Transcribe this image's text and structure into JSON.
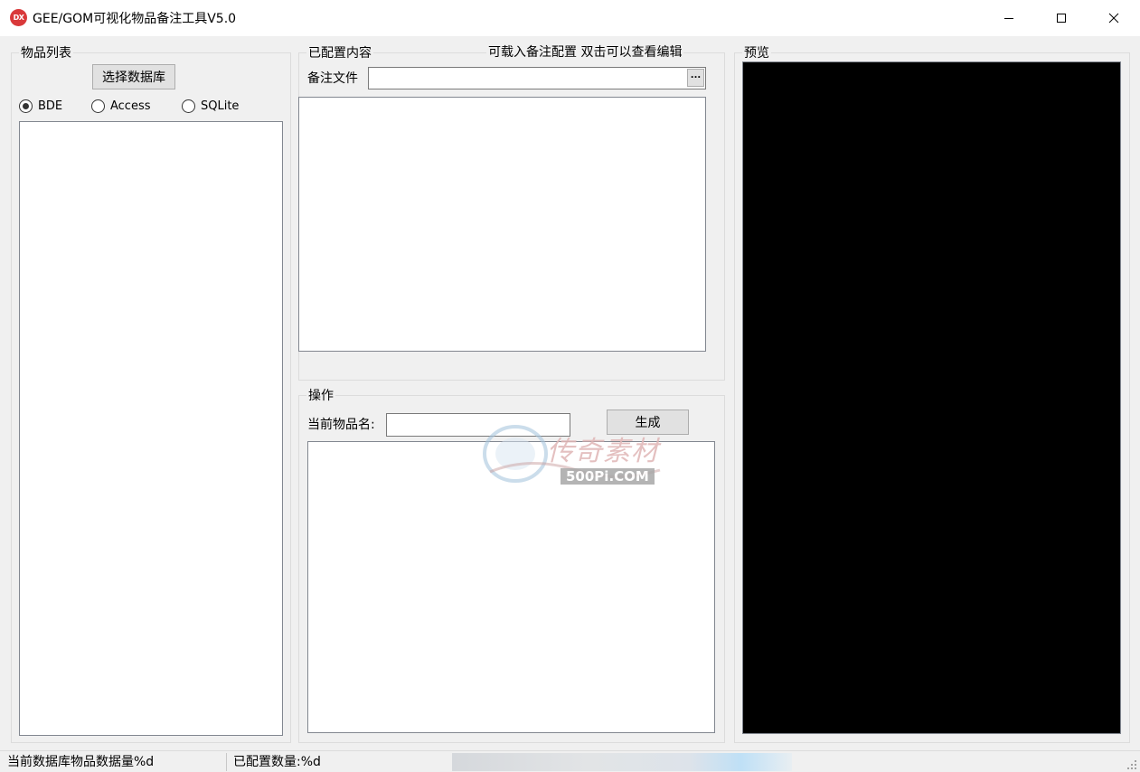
{
  "window": {
    "title": "GEE/GOM可视化物品备注工具V5.0",
    "icon_label": "DX",
    "icon_color": "#d9393a"
  },
  "item_list": {
    "group_title": "物品列表",
    "select_db_button": "选择数据库",
    "radio_options": [
      {
        "label": "BDE",
        "checked": true
      },
      {
        "label": "Access",
        "checked": false
      },
      {
        "label": "SQLite",
        "checked": false
      }
    ]
  },
  "configured": {
    "group_title": "已配置内容",
    "hint": "可载入备注配置 双击可以查看编辑",
    "file_label": "备注文件",
    "file_value": "",
    "browse_button": "..."
  },
  "operation": {
    "group_title": "操作",
    "item_name_label": "当前物品名:",
    "item_name_value": "",
    "generate_button": "生成"
  },
  "preview": {
    "group_title": "预览",
    "background": "#000000"
  },
  "statusbar": {
    "db_count": "当前数据库物品数据量%d",
    "configured_count": "已配置数量:%d"
  },
  "watermark": {
    "site_text": "500Pi.COM",
    "brand_text": "传奇素材"
  }
}
